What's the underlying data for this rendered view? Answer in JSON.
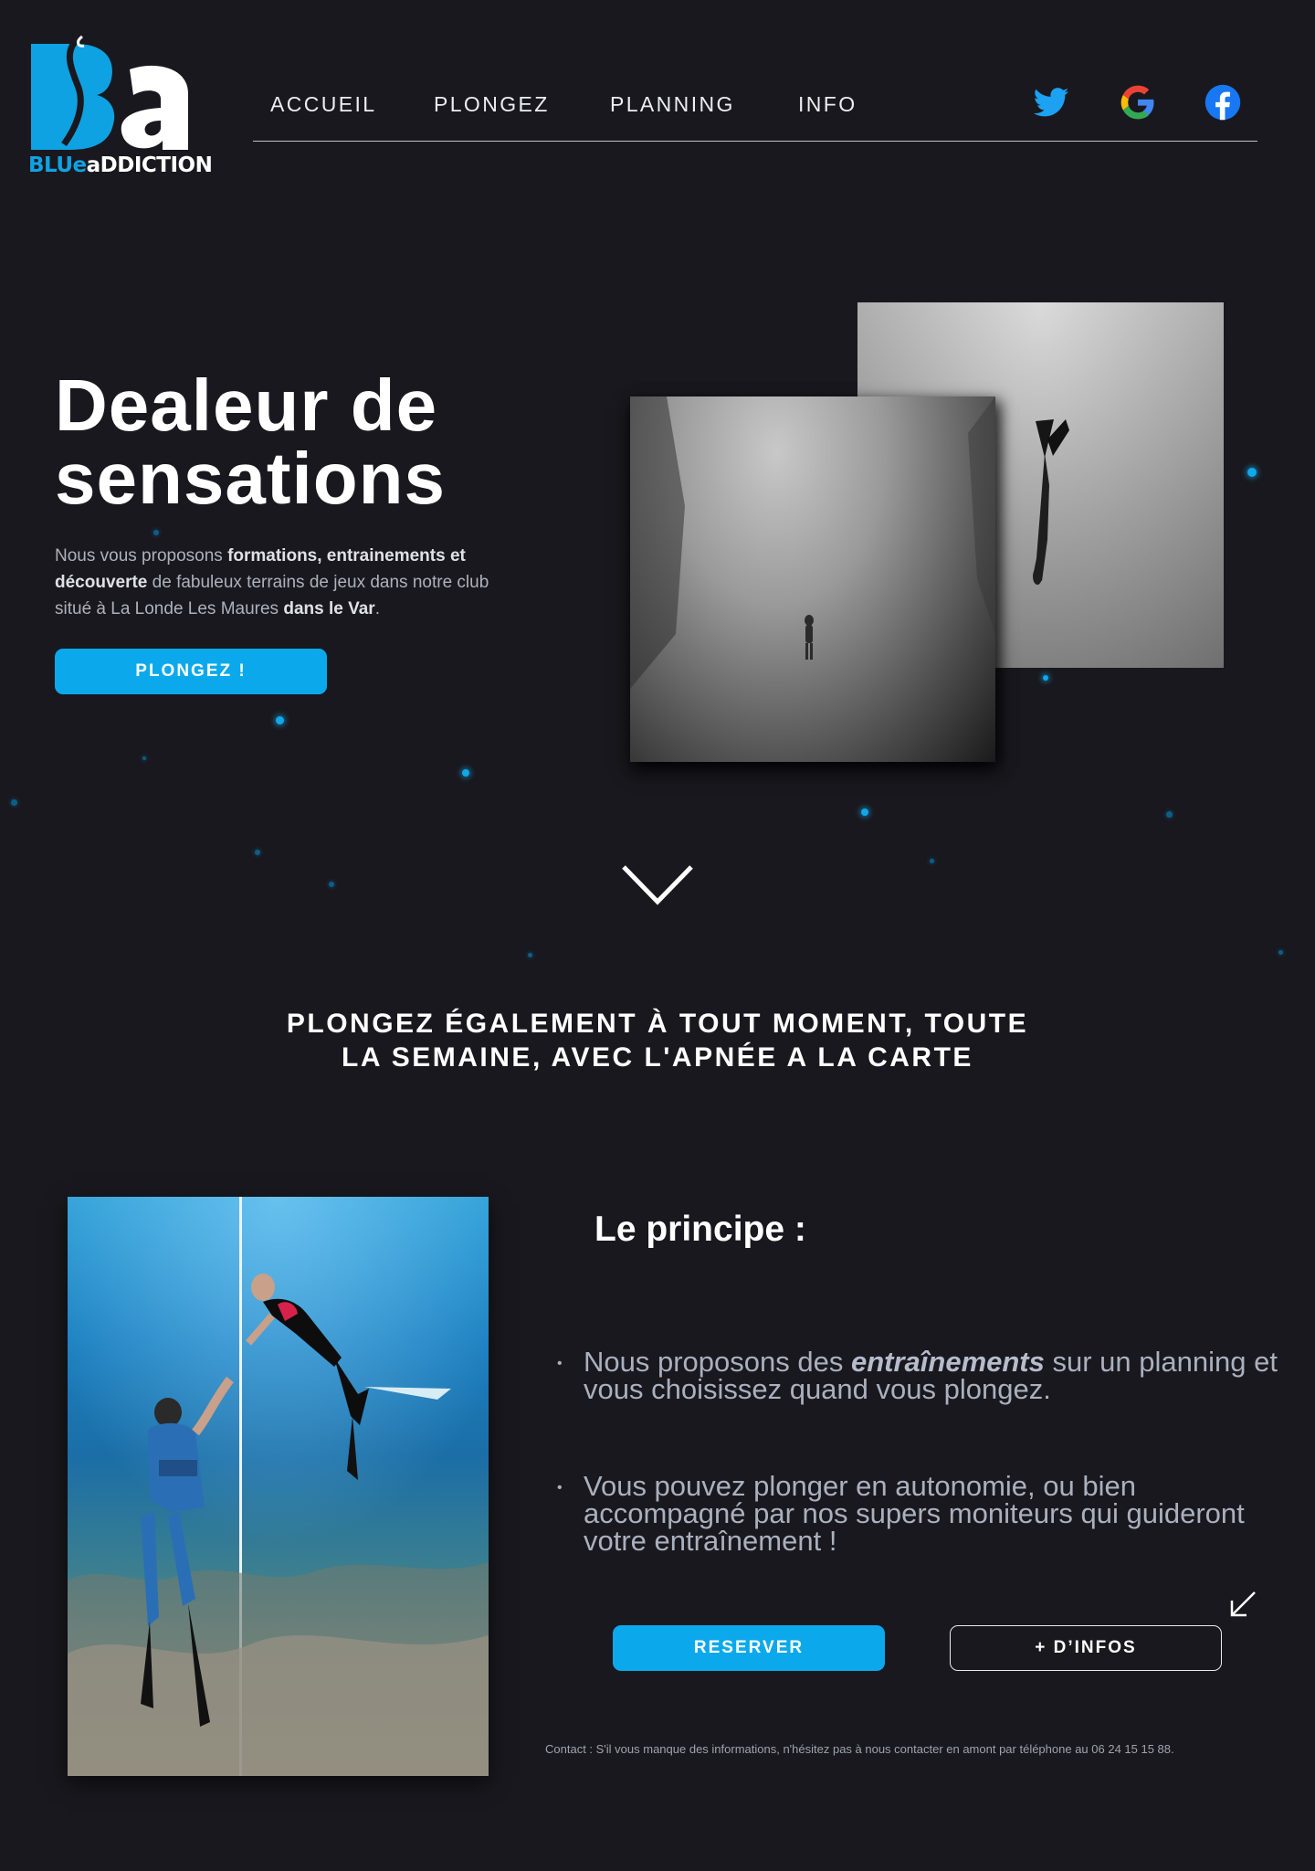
{
  "brand": {
    "logo_letters": "Ba",
    "logo_text_blue": "BLUe",
    "logo_text_white": "aDDICTION",
    "accent_color": "#0ba9ec"
  },
  "nav": {
    "items": [
      {
        "label": "ACCUEIL"
      },
      {
        "label": "PLONGEZ"
      },
      {
        "label": "PLANNING"
      },
      {
        "label": "INFO"
      }
    ],
    "social": [
      {
        "icon": "twitter-icon",
        "color": "#1da1f2"
      },
      {
        "icon": "google-icon",
        "color": "#ea4335"
      },
      {
        "icon": "facebook-icon",
        "color": "#1877f2"
      }
    ]
  },
  "hero": {
    "title_line1": "Dealeur de",
    "title_line2": "sensations",
    "text_part1": "Nous vous proposons ",
    "text_bold1": "formations, entrainements et découverte",
    "text_part2": " de fabuleux terrains de jeux dans notre club situé à La Londe Les Maures ",
    "text_bold2": "dans le Var",
    "text_part3": ".",
    "cta_label": "PLONGEZ !"
  },
  "section": {
    "heading_line1": "PLONGEZ ÉGALEMENT À TOUT MOMENT, TOUTE",
    "heading_line2": "LA SEMAINE, AVEC L'APNÉE A LA CARTE"
  },
  "principe": {
    "title": "Le principe :",
    "item1_part1": "Nous proposons des ",
    "item1_em": "entraînements",
    "item1_part2": " sur un planning et vous choisissez quand vous plongez.",
    "item2": "Vous pouvez plonger en autonomie, ou bien accompagné par nos supers moniteurs qui guideront votre entraînement !",
    "reserve_label": "RESERVER",
    "info_label": "+ D’INFOS"
  },
  "contact": {
    "text": "Contact : S'il vous manque des informations, n'hésitez pas à nous contacter en amont par téléphone au 06 24 15 15 88."
  }
}
